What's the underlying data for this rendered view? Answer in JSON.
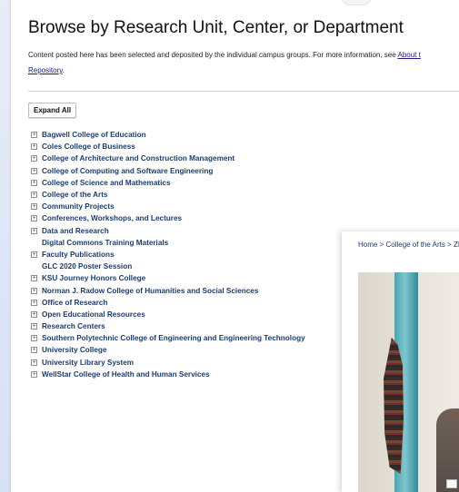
{
  "title": "Browse by Research Unit, Center, or Department",
  "intro": {
    "text": "Content posted here has been selected and deposited by the individual campus groups. For more information, see ",
    "link1": "About t",
    "link2": "Repository",
    "tail": "."
  },
  "expand_all_label": "Expand All",
  "units": [
    {
      "label": "Bagwell College of Education",
      "expandable": true
    },
    {
      "label": "Coles College of Business",
      "expandable": true
    },
    {
      "label": "College of Architecture and Construction Management",
      "expandable": true
    },
    {
      "label": "College of Computing and Software Engineering",
      "expandable": true
    },
    {
      "label": "College of Science and Mathematics",
      "expandable": true
    },
    {
      "label": "College of the Arts",
      "expandable": true
    },
    {
      "label": "Community Projects",
      "expandable": true
    },
    {
      "label": "Conferences, Workshops, and Lectures",
      "expandable": true
    },
    {
      "label": "Data and Research",
      "expandable": true
    },
    {
      "label": "Digital Commons Training Materials",
      "expandable": false
    },
    {
      "label": "Faculty Publications",
      "expandable": true
    },
    {
      "label": "GLC 2020 Poster Session",
      "expandable": false
    },
    {
      "label": "KSU Journey Honors College",
      "expandable": true
    },
    {
      "label": "Norman J. Radow College of Humanities and Social Sciences",
      "expandable": true
    },
    {
      "label": "Office of Research",
      "expandable": true
    },
    {
      "label": "Open Educational Resources",
      "expandable": true
    },
    {
      "label": "Research Centers",
      "expandable": true
    },
    {
      "label": "Southern Polytechnic College of Engineering and Engineering Technology",
      "expandable": true
    },
    {
      "label": "University College",
      "expandable": true
    },
    {
      "label": "University Library System",
      "expandable": true
    },
    {
      "label": "WellStar College of Health and Human Services",
      "expandable": true
    }
  ],
  "overlay": {
    "breadcrumb": "Home > College of the Arts > ZMA"
  }
}
